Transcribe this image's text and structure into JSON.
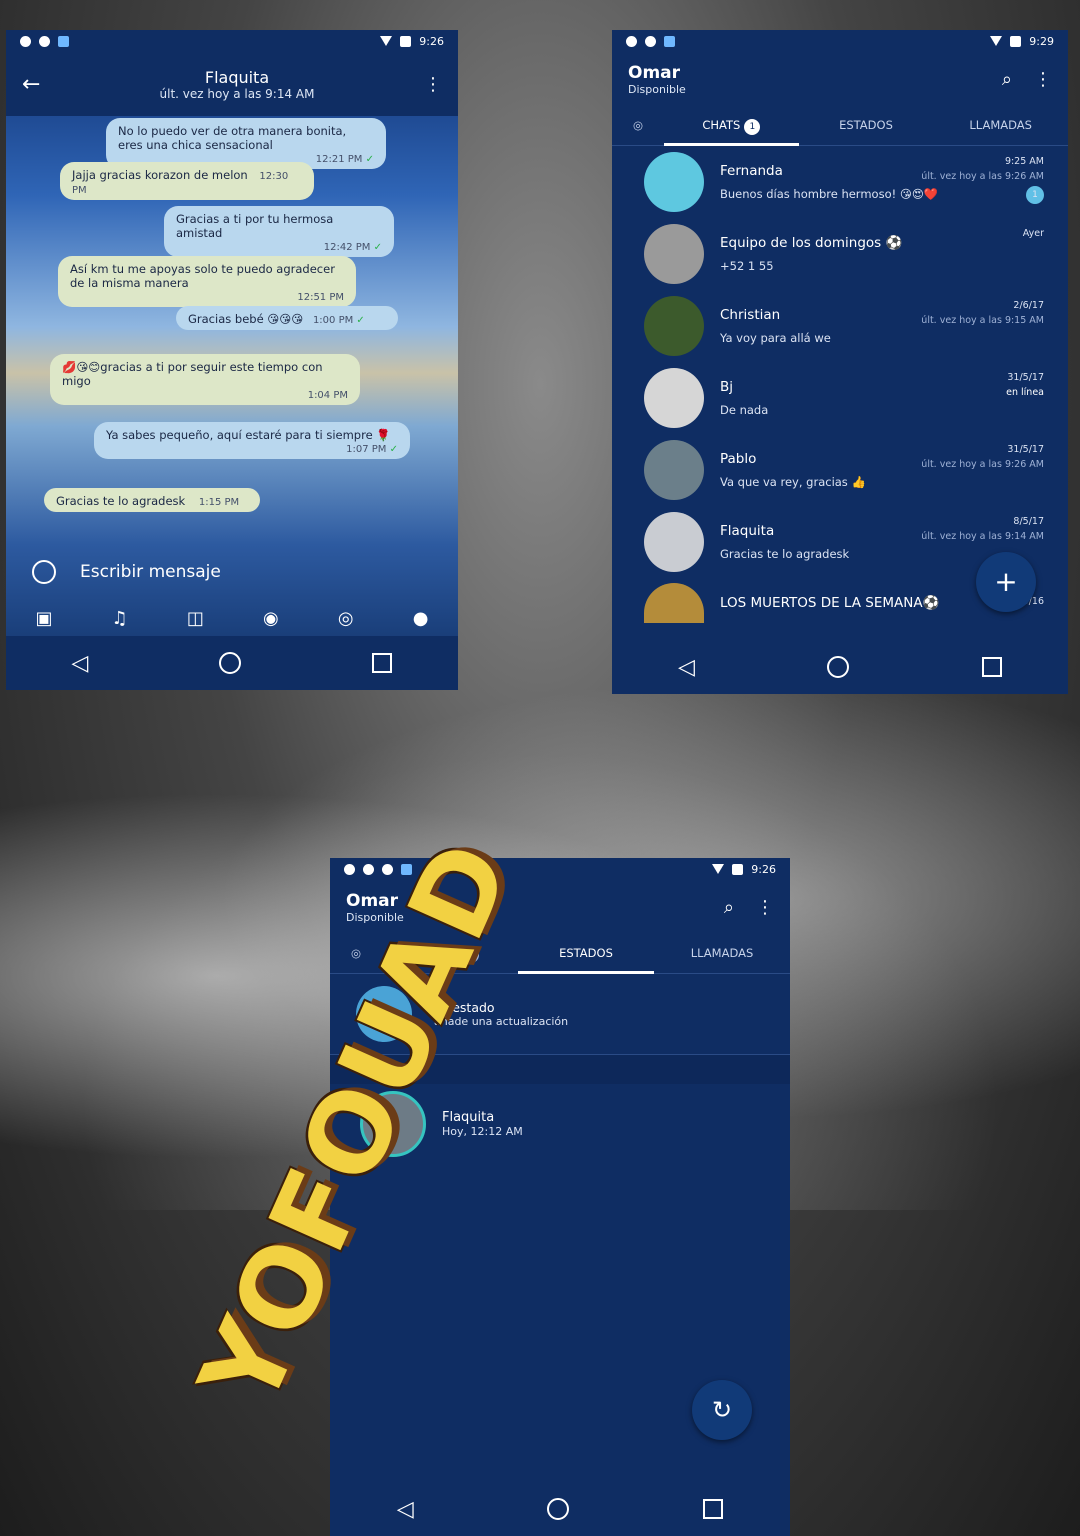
{
  "chat_screen": {
    "status_time": "9:26",
    "contact_name": "Flaquita",
    "last_seen": "últ. vez hoy a las 9:14 AM",
    "messages": [
      {
        "dir": "out",
        "text": "No lo puedo ver de otra manera bonita, eres una chica sensacional",
        "time": "12:21 PM"
      },
      {
        "dir": "in",
        "text": "Jajja gracias korazon de melon",
        "time": "12:30 PM"
      },
      {
        "dir": "out",
        "text": "Gracias a ti por tu hermosa amistad",
        "time": "12:42 PM"
      },
      {
        "dir": "in",
        "text": "Así km tu me apoyas solo te puedo agradecer de la misma manera",
        "time": "12:51 PM"
      },
      {
        "dir": "out",
        "text": "Gracias bebé 😘😘😘",
        "time": "1:00 PM"
      },
      {
        "dir": "in",
        "text": "💋😘😊gracias a ti por seguir este tiempo con migo",
        "time": "1:04 PM"
      },
      {
        "dir": "out",
        "text": "Ya sabes pequeño, aquí estaré para ti siempre 🌹",
        "time": "1:07 PM"
      },
      {
        "dir": "in",
        "text": "Gracias te lo agradesk",
        "time": "1:15 PM"
      }
    ],
    "composer_placeholder": "Escribir mensaje"
  },
  "list_screen": {
    "status_time": "9:29",
    "user_name": "Omar",
    "user_status": "Disponible",
    "tabs": [
      {
        "label": "CHATS",
        "badge": "1"
      },
      {
        "label": "ESTADOS",
        "badge": ""
      },
      {
        "label": "LLAMADAS",
        "badge": ""
      }
    ],
    "chats": [
      {
        "name": "Fernanda",
        "preview": "Buenos días hombre hermoso! 😘😍❤️",
        "date": "9:25 AM",
        "last_seen": "últ. vez hoy a las 9:26 AM",
        "unread": "1"
      },
      {
        "name": "Equipo de los domingos ⚽",
        "preview": "+52 1 55",
        "date": "Ayer",
        "last_seen": "",
        "unread": ""
      },
      {
        "name": "Christian",
        "preview": "Ya voy para allá we",
        "date": "2/6/17",
        "last_seen": "últ. vez hoy a las 9:15 AM",
        "unread": ""
      },
      {
        "name": "Bj",
        "preview": "De nada",
        "date": "31/5/17",
        "last_seen": "en línea",
        "unread": ""
      },
      {
        "name": "Pablo",
        "preview": "Va que va rey, gracias 👍",
        "date": "31/5/17",
        "last_seen": "últ. vez hoy a las 9:26 AM",
        "unread": ""
      },
      {
        "name": "Flaquita",
        "preview": "Gracias te lo agradesk",
        "date": "8/5/17",
        "last_seen": "últ. vez hoy a las 9:14 AM",
        "unread": ""
      },
      {
        "name": "LOS MUERTOS DE LA SEMANA⚽",
        "preview": "",
        "date": "27/10/16",
        "last_seen": "",
        "unread": ""
      }
    ],
    "fab_label": "+"
  },
  "status_screen": {
    "status_time": "9:26",
    "user_name": "Omar",
    "user_status": "Disponible",
    "tabs": [
      {
        "label": "CHATS",
        "badge": "1"
      },
      {
        "label": "ESTADOS",
        "badge": ""
      },
      {
        "label": "LLAMADAS",
        "badge": ""
      }
    ],
    "my_status_title": "Mi estado",
    "my_status_sub": "añade una actualización",
    "recent_label": "Recientes",
    "recent": [
      {
        "name": "Flaquita",
        "time": "Hoy, 12:12 AM"
      }
    ]
  },
  "watermark": "YOFOUAD",
  "colors": {
    "app_bg": "#0f2d63",
    "accent": "#4aa3d6",
    "check": "#2bb14a",
    "brand": "#f2d142"
  }
}
